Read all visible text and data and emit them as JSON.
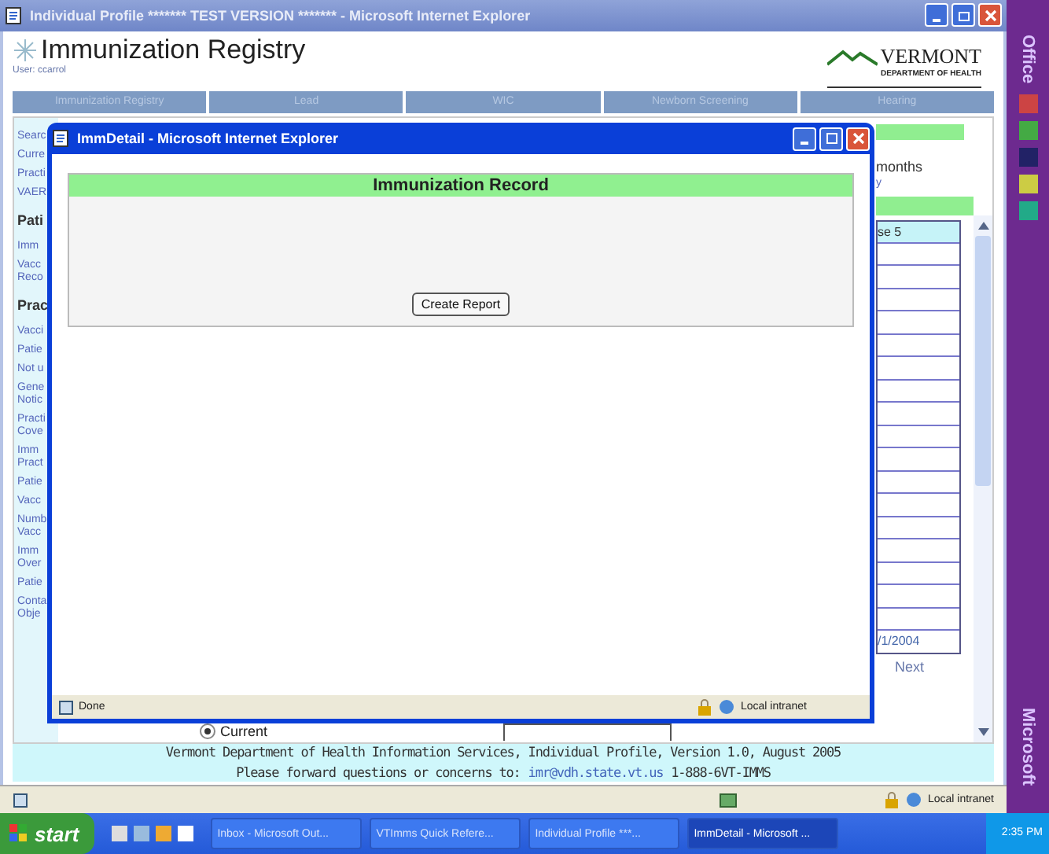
{
  "window": {
    "title": "Individual Profile ******* TEST VERSION ******* - Microsoft Internet Explorer"
  },
  "header": {
    "title": "Immunization Registry",
    "user": "User: ccarrol",
    "logo_text": "VERMONT",
    "logo_subtitle": "DEPARTMENT OF HEALTH"
  },
  "nav_tabs": [
    {
      "label": "Immunization Registry"
    },
    {
      "label": "Lead"
    },
    {
      "label": "WIC"
    },
    {
      "label": "Newborn Screening"
    },
    {
      "label": "Hearing"
    }
  ],
  "left_menu": [
    {
      "label": "Searc",
      "kind": "link"
    },
    {
      "label": "Curre",
      "kind": "link"
    },
    {
      "label": "Practi",
      "kind": "link"
    },
    {
      "label": "VAER",
      "kind": "link"
    },
    {
      "label": "Pati",
      "kind": "heading"
    },
    {
      "label": "Imm",
      "kind": "link"
    },
    {
      "label": "Vacc Reco",
      "kind": "link"
    },
    {
      "label": "Prac",
      "kind": "heading"
    },
    {
      "label": "Vacci",
      "kind": "link"
    },
    {
      "label": "Patie",
      "kind": "link"
    },
    {
      "label": "Not u",
      "kind": "link"
    },
    {
      "label": "Gene Notic",
      "kind": "link"
    },
    {
      "label": "Practi Cove",
      "kind": "link"
    },
    {
      "label": "Imm Pract",
      "kind": "link"
    },
    {
      "label": "Patie",
      "kind": "link"
    },
    {
      "label": "Vacc",
      "kind": "link"
    },
    {
      "label": "Numb Vacc",
      "kind": "link"
    },
    {
      "label": "Imm Over",
      "kind": "link"
    },
    {
      "label": "Patie",
      "kind": "link"
    },
    {
      "label": "Conta Obje",
      "kind": "link"
    }
  ],
  "right_panel": {
    "text": "months",
    "link": "y",
    "table_header": "se 5",
    "last_cell": "/1/2004",
    "next": "Next"
  },
  "current_option": {
    "label": "Current",
    "selected": true
  },
  "footer": {
    "line1": "Vermont Department of Health Information Services, Individual Profile, Version 1.0, August 2005",
    "prefix": "Please forward questions or concerns to:",
    "email": "imr@vdh.state.vt.us",
    "phone": "1-888-6VT-IMMS"
  },
  "status_bar": {
    "zone": "Local intranet"
  },
  "popup": {
    "title": "ImmDetail - Microsoft Internet Explorer",
    "heading": "Immunization Record",
    "button": "Create Report",
    "status": "Done",
    "zone": "Local intranet"
  },
  "taskbar": {
    "start": "start",
    "tasks": [
      {
        "label": "Inbox - Microsoft Out...",
        "selected": false
      },
      {
        "label": "VTImms Quick Refere...",
        "selected": false
      },
      {
        "label": "Individual Profile ***...",
        "selected": false
      },
      {
        "label": "ImmDetail - Microsoft ...",
        "selected": true
      }
    ],
    "clock": "2:35 PM"
  },
  "office_bar": {
    "top": "Office",
    "bottom": "Microsoft"
  }
}
